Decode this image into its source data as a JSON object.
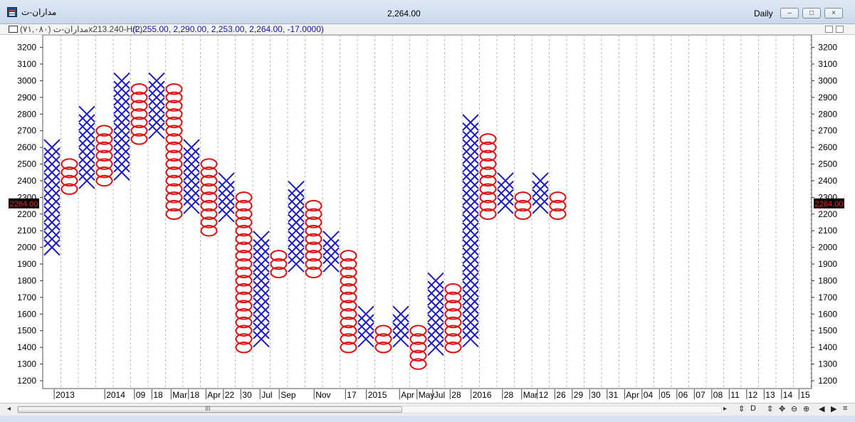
{
  "window": {
    "title": "مداران-ت",
    "price": "2,264.00",
    "period": "Daily",
    "min_icon": "minimize-icon",
    "restore_icon": "restore-icon",
    "close_icon": "close-icon"
  },
  "infobar": {
    "name": "مداران-ت (۷۱,۰۸۰)x213.240-H/L)",
    "values": "(2,255.00, 2,290.00, 2,253.00, 2,264.00, -17.0000)"
  },
  "colors": {
    "x": "#1a1ac8",
    "o": "#e01010",
    "grid": "#bdbdbd",
    "price_tag_bg": "#000000",
    "price_tag_fg": "#ff2020"
  },
  "chart_data": {
    "type": "point-and-figure",
    "box_size": 50,
    "ylim": [
      1150,
      3250
    ],
    "y_ticks": [
      1200,
      1300,
      1400,
      1500,
      1600,
      1700,
      1800,
      1900,
      2000,
      2100,
      2200,
      2300,
      2400,
      2500,
      2600,
      2700,
      2800,
      2900,
      3000,
      3100,
      3200
    ],
    "current_price_label": "2264.00",
    "current_price": 2264,
    "columns": [
      {
        "type": "X",
        "low": 2000,
        "high": 2600
      },
      {
        "type": "O",
        "low": 2350,
        "high": 2500
      },
      {
        "type": "X",
        "low": 2400,
        "high": 2800
      },
      {
        "type": "O",
        "low": 2400,
        "high": 2700
      },
      {
        "type": "X",
        "low": 2450,
        "high": 3000
      },
      {
        "type": "O",
        "low": 2650,
        "high": 2950
      },
      {
        "type": "X",
        "low": 2700,
        "high": 3000
      },
      {
        "type": "O",
        "low": 2200,
        "high": 2950
      },
      {
        "type": "X",
        "low": 2250,
        "high": 2600
      },
      {
        "type": "O",
        "low": 2100,
        "high": 2500
      },
      {
        "type": "X",
        "low": 2200,
        "high": 2400
      },
      {
        "type": "O",
        "low": 1400,
        "high": 2300
      },
      {
        "type": "X",
        "low": 1450,
        "high": 2050
      },
      {
        "type": "O",
        "low": 1850,
        "high": 1950
      },
      {
        "type": "X",
        "low": 1900,
        "high": 2350
      },
      {
        "type": "O",
        "low": 1850,
        "high": 2250
      },
      {
        "type": "X",
        "low": 1900,
        "high": 2050
      },
      {
        "type": "O",
        "low": 1400,
        "high": 1950
      },
      {
        "type": "X",
        "low": 1450,
        "high": 1600
      },
      {
        "type": "O",
        "low": 1400,
        "high": 1500
      },
      {
        "type": "X",
        "low": 1450,
        "high": 1600
      },
      {
        "type": "O",
        "low": 1300,
        "high": 1500
      },
      {
        "type": "X",
        "low": 1400,
        "high": 1800
      },
      {
        "type": "O",
        "low": 1400,
        "high": 1750
      },
      {
        "type": "X",
        "low": 1450,
        "high": 2750
      },
      {
        "type": "O",
        "low": 2200,
        "high": 2650
      },
      {
        "type": "X",
        "low": 2250,
        "high": 2400
      },
      {
        "type": "O",
        "low": 2200,
        "high": 2300
      },
      {
        "type": "X",
        "low": 2250,
        "high": 2400
      },
      {
        "type": "O",
        "low": 2200,
        "high": 2300
      }
    ],
    "x_labels": [
      {
        "col": 0.7,
        "text": "2013"
      },
      {
        "col": 3.6,
        "text": "2014"
      },
      {
        "col": 5.3,
        "text": "09"
      },
      {
        "col": 6.3,
        "text": "18"
      },
      {
        "col": 7.4,
        "text": "Mar"
      },
      {
        "col": 8.4,
        "text": "18"
      },
      {
        "col": 9.4,
        "text": "Apr"
      },
      {
        "col": 10.4,
        "text": "22"
      },
      {
        "col": 11.4,
        "text": "30"
      },
      {
        "col": 12.5,
        "text": "Jul"
      },
      {
        "col": 13.6,
        "text": "Sep"
      },
      {
        "col": 15.6,
        "text": "Nov"
      },
      {
        "col": 17.4,
        "text": "17"
      },
      {
        "col": 18.6,
        "text": "2015"
      },
      {
        "col": 20.5,
        "text": "Apr"
      },
      {
        "col": 21.5,
        "text": "May"
      },
      {
        "col": 22.4,
        "text": "Jul"
      },
      {
        "col": 23.4,
        "text": "28"
      },
      {
        "col": 24.6,
        "text": "2016"
      },
      {
        "col": 26.4,
        "text": "28"
      },
      {
        "col": 27.5,
        "text": "Mar"
      },
      {
        "col": 28.4,
        "text": "12"
      },
      {
        "col": 29.4,
        "text": "26"
      },
      {
        "col": 30.4,
        "text": "29"
      },
      {
        "col": 31.4,
        "text": "30"
      },
      {
        "col": 32.4,
        "text": "31"
      },
      {
        "col": 33.4,
        "text": "Apr"
      },
      {
        "col": 34.4,
        "text": "04"
      },
      {
        "col": 35.4,
        "text": "05"
      },
      {
        "col": 36.4,
        "text": "06"
      },
      {
        "col": 37.4,
        "text": "07"
      },
      {
        "col": 38.4,
        "text": "08"
      },
      {
        "col": 39.4,
        "text": "11"
      },
      {
        "col": 40.4,
        "text": "12"
      },
      {
        "col": 41.4,
        "text": "13"
      },
      {
        "col": 42.4,
        "text": "14"
      },
      {
        "col": 43.4,
        "text": "15"
      }
    ]
  },
  "statusbar": {
    "scroll_left": "◂",
    "scroll_grip": "III",
    "scroll_right": "▸",
    "tools": [
      "⇕",
      "D",
      "⇕",
      "✥",
      "⊖",
      "⊕",
      "◀",
      "▶",
      "≡"
    ]
  }
}
